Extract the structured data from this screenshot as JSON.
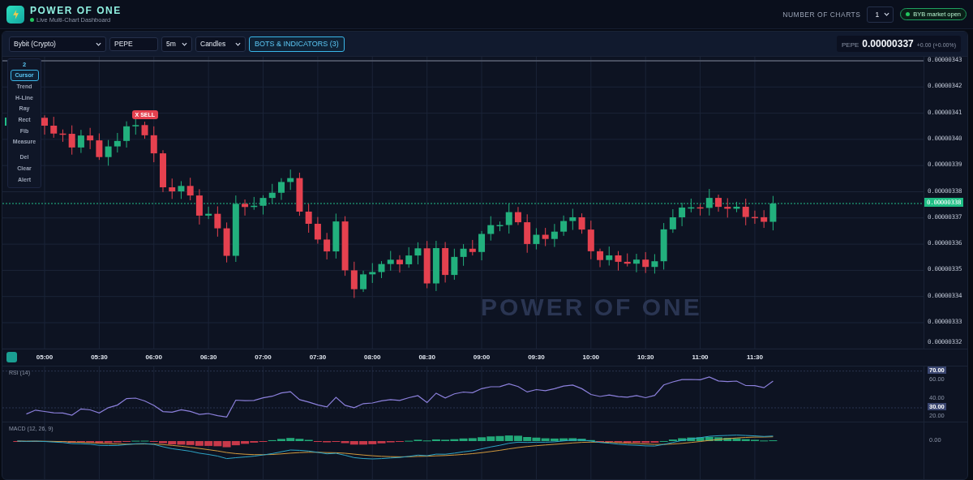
{
  "header": {
    "title": "POWER OF ONE",
    "subtitle": "Live Multi-Chart Dashboard",
    "charts_label": "NUMBER OF CHARTS",
    "charts_value": "1",
    "market_status": "BYB market open",
    "market_open": true
  },
  "toolbar": {
    "exchange": "Bybit (Crypto)",
    "symbol": "PEPE",
    "interval": "5m",
    "chart_type": "Candles",
    "indicators_button": "BOTS & INDICATORS (3)",
    "price_symbol": "PEPE",
    "price": "0.00000337",
    "change": "+0.00 (+0.00%)"
  },
  "drawing_tools": {
    "count": "2",
    "tools": [
      {
        "label": "Cursor",
        "selected": true
      },
      {
        "label": "Trend",
        "selected": false
      },
      {
        "label": "H-Line",
        "selected": false
      },
      {
        "label": "Ray",
        "selected": false
      },
      {
        "label": "Rect",
        "selected": false
      },
      {
        "label": "Fib",
        "selected": false
      },
      {
        "label": "Measure",
        "selected": false
      },
      {
        "label": "Del",
        "selected": false
      },
      {
        "label": "Clear",
        "selected": false
      },
      {
        "label": "Alert",
        "selected": false
      }
    ]
  },
  "chart": {
    "watermark": "POWER OF ONE",
    "signal": "X SELL",
    "price_ticks": [
      "0.00000343",
      "0.00000342",
      "0.00000341",
      "0.00000340",
      "0.00000339",
      "0.00000338",
      "0.00000337",
      "0.00000336",
      "0.00000335",
      "0.00000334",
      "0.00000333",
      "0.00000332"
    ],
    "current_price": "0.00000338",
    "time_ticks": [
      "05:00",
      "05:30",
      "06:00",
      "06:30",
      "07:00",
      "07:30",
      "08:00",
      "08:30",
      "09:00",
      "09:30",
      "10:00",
      "10:30",
      "11:00",
      "11:30"
    ]
  },
  "rsi": {
    "title": "RSI (14)",
    "ticks": [
      {
        "label": "70.00",
        "highlighted": true
      },
      {
        "label": "60.00",
        "highlighted": false
      },
      {
        "label": "40.00",
        "highlighted": false
      },
      {
        "label": "30.00",
        "highlighted": true
      },
      {
        "label": "20.00",
        "highlighted": false
      }
    ]
  },
  "macd": {
    "title": "MACD (12, 26, 9)",
    "zero_label": "0.00"
  }
}
